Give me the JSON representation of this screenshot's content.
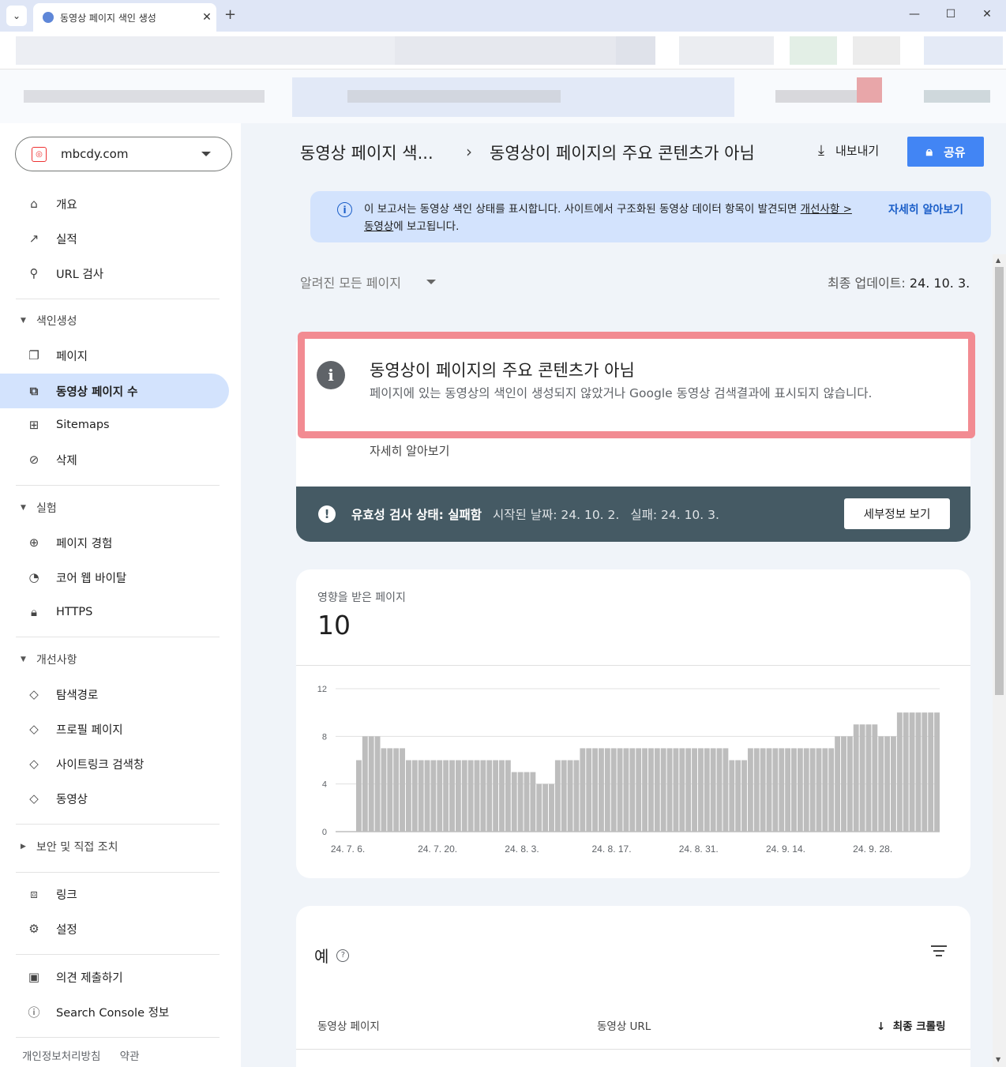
{
  "browser": {
    "tab_title": "동영상 페이지 색인 생성",
    "tab_close": "✕",
    "new_tab": "+",
    "dropdown_glyph": "⌄",
    "minimize": "—",
    "maximize": "☐",
    "close": "✕"
  },
  "sidebar": {
    "property": "mbcdy.com",
    "items_top": [
      {
        "label": "개요",
        "icon": "home-icon"
      },
      {
        "label": "실적",
        "icon": "trending-up-icon"
      },
      {
        "label": "URL 검사",
        "icon": "search-icon"
      }
    ],
    "section_indexing": "색인생성",
    "items_indexing": [
      {
        "label": "페이지",
        "icon": "pages-icon"
      },
      {
        "label": "동영상 페이지 수",
        "icon": "video-pages-icon"
      },
      {
        "label": "Sitemaps",
        "icon": "sitemap-icon"
      },
      {
        "label": "삭제",
        "icon": "visibility-off-icon"
      }
    ],
    "section_experience": "실험",
    "items_experience": [
      {
        "label": "페이지 경험",
        "icon": "page-experience-icon"
      },
      {
        "label": "코어 웹 바이탈",
        "icon": "speed-gauge-icon"
      },
      {
        "label": "HTTPS",
        "icon": "lock-icon"
      }
    ],
    "section_enhancements": "개선사항",
    "items_enhancements": [
      {
        "label": "탐색경로",
        "icon": "layers-icon"
      },
      {
        "label": "프로필 페이지",
        "icon": "layers-icon"
      },
      {
        "label": "사이트링크 검색창",
        "icon": "layers-icon"
      },
      {
        "label": "동영상",
        "icon": "layers-icon"
      }
    ],
    "section_security": "보안 및 직접 조치",
    "items_other": [
      {
        "label": "링크",
        "icon": "links-icon"
      },
      {
        "label": "설정",
        "icon": "settings-icon"
      }
    ],
    "items_bottom": [
      {
        "label": "의견 제출하기",
        "icon": "feedback-icon"
      },
      {
        "label": "Search Console 정보",
        "icon": "info-icon"
      }
    ],
    "footer": [
      "개인정보처리방침",
      "약관"
    ]
  },
  "header": {
    "breadcrumb_parent": "동영상 페이지 색...",
    "breadcrumb_sep": "›",
    "breadcrumb_current": "동영상이 페이지의 주요 콘텐츠가 아님",
    "export_label": "내보내기",
    "share_label": "공유"
  },
  "info_banner": {
    "text_before": "이 보고서는 동영상 색인 상태를 표시합니다. 사이트에서 구조화된 동영상 데이터 항목이 발견되면 ",
    "link_text": "개선사항 > 동영상",
    "text_after": "에 보고됩니다.",
    "more_label": "자세히 알아보기"
  },
  "filter": {
    "label": "알려진 모든 페이지",
    "last_update_label": "최종 업데이트:",
    "last_update_value": "24. 10. 3."
  },
  "issue": {
    "title": "동영상이 페이지의 주요 콘텐츠가 아님",
    "description": "페이지에 있는 동영상의 색인이 생성되지 않았거나 Google 동영상 검색결과에 표시되지 않습니다.",
    "more_label": "자세히 알아보기",
    "validation_status": "유효성 검사 상태: 실패함",
    "started": "시작된 날짜: 24. 10. 2.",
    "failed": "실패: 24. 10. 3.",
    "details_button": "세부정보 보기"
  },
  "affected": {
    "label": "영향을 받은 페이지",
    "value": "10"
  },
  "chart_data": {
    "type": "bar",
    "ylim": [
      0,
      12
    ],
    "yticks": [
      "0",
      "4",
      "8",
      "12"
    ],
    "xtick_labels": [
      "24. 7. 6.",
      "24. 7. 20.",
      "24. 8. 3.",
      "24. 8. 17.",
      "24. 8. 31.",
      "24. 9. 14.",
      "24. 9. 28."
    ],
    "xtick_index": [
      1,
      15,
      29,
      43,
      57,
      71,
      85
    ],
    "bar_color": "#bdbdbd",
    "values": [
      6,
      8,
      8,
      8,
      7,
      7,
      7,
      7,
      6,
      6,
      6,
      6,
      6,
      6,
      6,
      6,
      6,
      6,
      6,
      6,
      6,
      6,
      6,
      6,
      6,
      5,
      5,
      5,
      5,
      4,
      4,
      4,
      6,
      6,
      6,
      6,
      7,
      7,
      7,
      7,
      7,
      7,
      7,
      7,
      7,
      7,
      7,
      7,
      7,
      7,
      7,
      7,
      7,
      7,
      7,
      7,
      7,
      7,
      7,
      7,
      6,
      6,
      6,
      7,
      7,
      7,
      7,
      7,
      7,
      7,
      7,
      7,
      7,
      7,
      7,
      7,
      7,
      8,
      8,
      8,
      9,
      9,
      9,
      9,
      8,
      8,
      8,
      10,
      10,
      10,
      10,
      10,
      10,
      10
    ]
  },
  "examples": {
    "title": "예",
    "col_page": "동영상 페이지",
    "col_url": "동영상 URL",
    "col_crawl": "최종 크롤링",
    "sort_glyph": "↓"
  }
}
